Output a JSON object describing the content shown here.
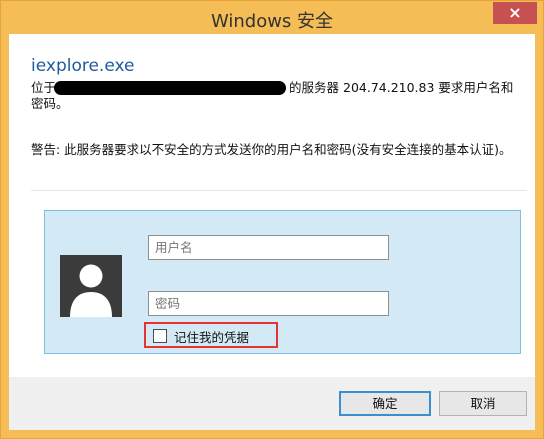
{
  "window": {
    "title": "Windows 安全",
    "close_label": "×"
  },
  "dialog": {
    "app_name": "iexplore.exe",
    "message_prefix": "位于",
    "message_suffix": "的服务器 204.74.210.83 要求用户名和",
    "message_line2": "密码。",
    "warning": "警告: 此服务器要求以不安全的方式发送你的用户名和密码(没有安全连接的基本认证)。"
  },
  "credentials": {
    "username_placeholder": "用户名",
    "password_placeholder": "密码",
    "remember_label": "记住我的凭据"
  },
  "buttons": {
    "ok": "确定",
    "cancel": "取消"
  },
  "colors": {
    "titlebar": "#f4bd55",
    "close": "#c75050",
    "panel": "#d3eaf6",
    "highlight": "#e53232"
  }
}
